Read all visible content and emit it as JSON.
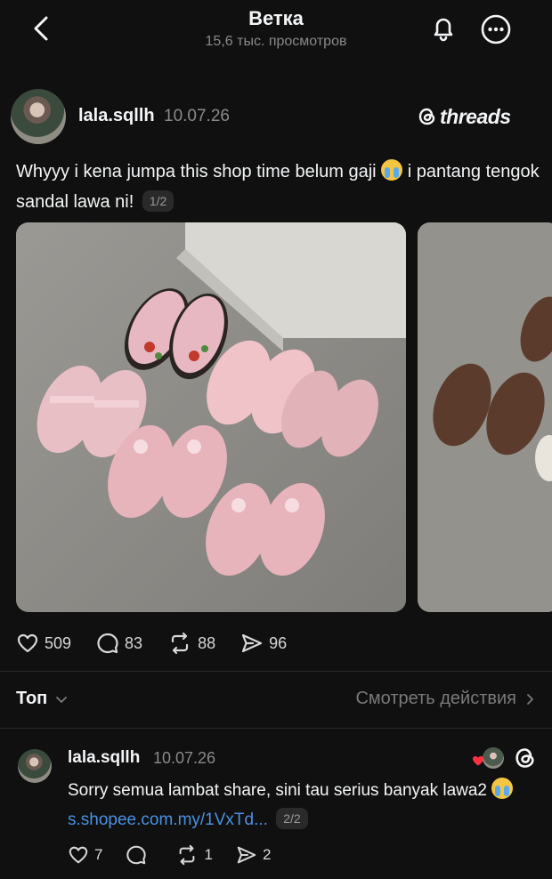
{
  "header": {
    "title": "Ветка",
    "views": "15,6 тыс. просмотров"
  },
  "post": {
    "username": "lala.sqllh",
    "date": "10.07.26",
    "brand": "threads",
    "text_part1": "Whyyy i kena jumpa this shop time belum gaji",
    "text_part2": "i pantang tengok sandal lawa ni!",
    "page_indicator": "1/2",
    "likes": "509",
    "comments": "83",
    "reposts": "88",
    "shares": "96"
  },
  "sort": {
    "label": "Топ",
    "activity": "Смотреть действия"
  },
  "reply": {
    "username": "lala.sqllh",
    "date": "10.07.26",
    "text": "Sorry semua lambat share, sini tau serius banyak lawa2",
    "link": "s.shopee.com.my/1VxTd...",
    "page_indicator": "2/2",
    "likes": "7",
    "comments": "",
    "reposts": "1",
    "shares": "2"
  },
  "colors": {
    "background": "#101010",
    "text": "#f3f5f7",
    "muted": "#8a8a8a",
    "link": "#4a90e2",
    "like_badge": "#ff3040"
  },
  "icons": [
    "back-arrow-icon",
    "bell-icon",
    "more-icon",
    "threads-logo-icon",
    "heart-icon",
    "comment-icon",
    "repost-icon",
    "share-icon",
    "chevron-down-icon",
    "chevron-right-icon",
    "loudly-crying-face-emoji"
  ]
}
